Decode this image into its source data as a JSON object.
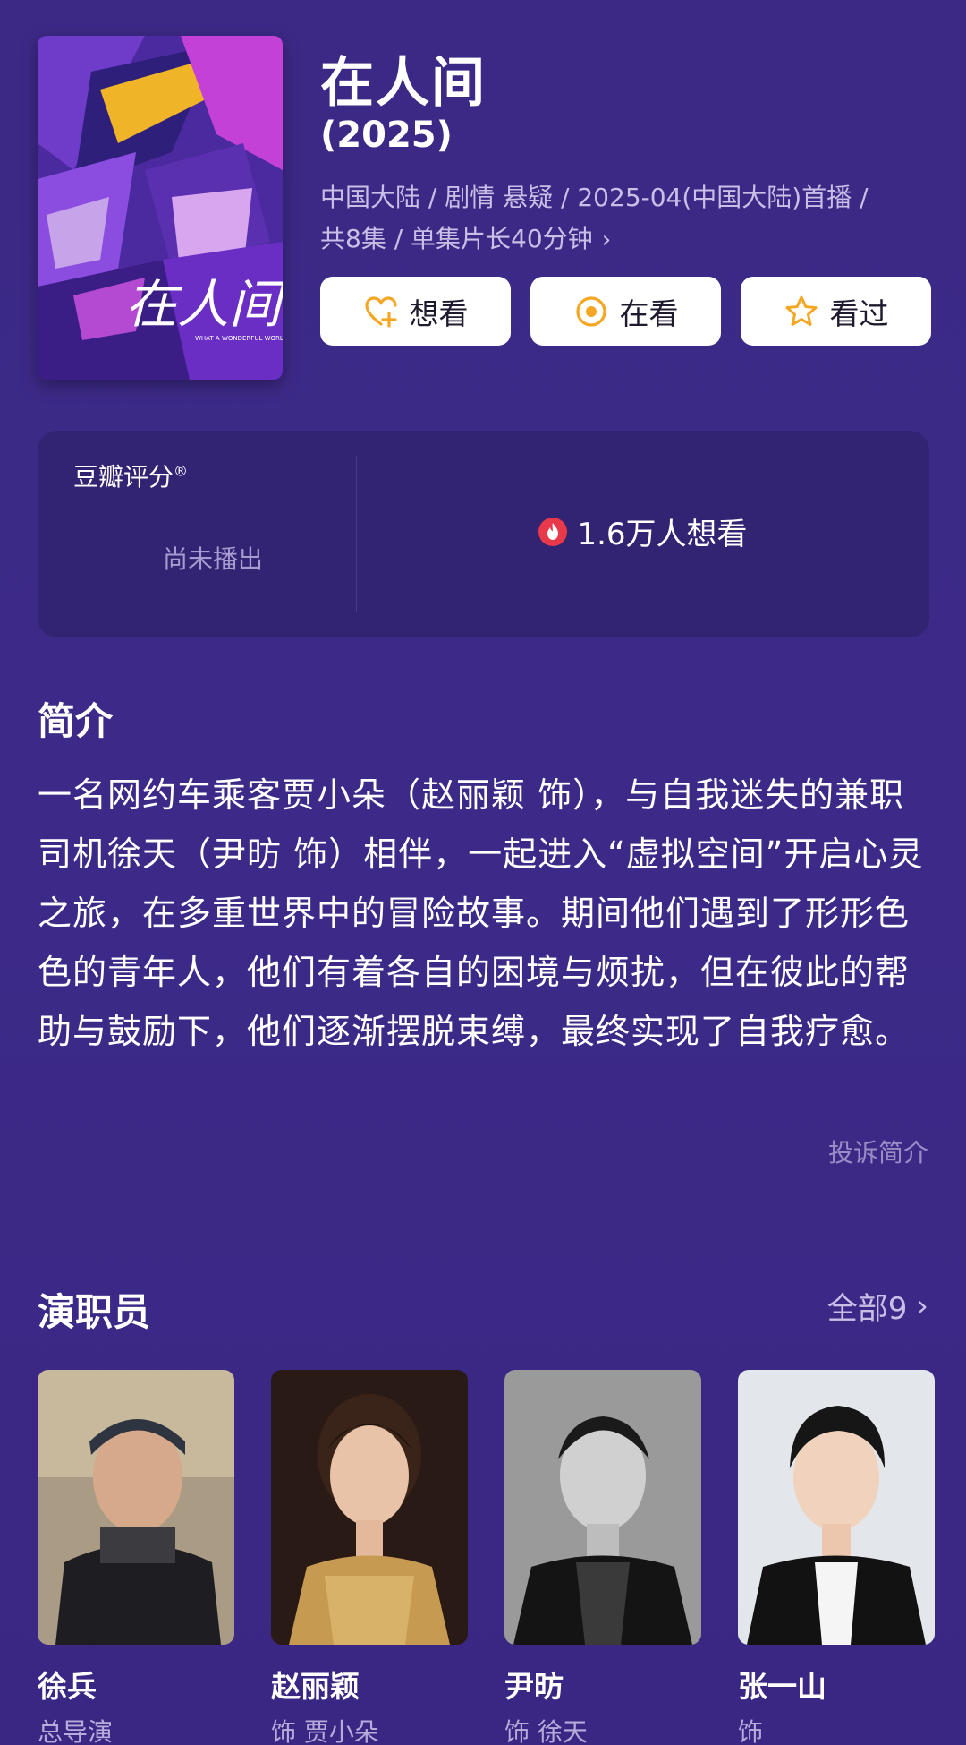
{
  "header": {
    "title": "在人间",
    "year": "(2025)",
    "meta_line1": "中国大陆 / 剧情 悬疑 / 2025-04(中国大陆)首播 /",
    "meta_line2": "共8集 / 单集片长40分钟",
    "poster_text": "在人间",
    "poster_subtitle": "WHAT A WONDERFUL WORLD"
  },
  "actions": [
    {
      "label": "想看",
      "icon": "heart-plus-icon"
    },
    {
      "label": "在看",
      "icon": "dot-circle-icon"
    },
    {
      "label": "看过",
      "icon": "star-icon"
    }
  ],
  "rating": {
    "title": "豆瓣评分",
    "mark": "®",
    "status": "尚未播出",
    "want_count": "1.6万人想看"
  },
  "synopsis": {
    "title": "简介",
    "text": "一名网约车乘客贾小朵（赵丽颖 饰），与自我迷失的兼职司机徐天（尹昉 饰）相伴，一起进入“虚拟空间”开启心灵之旅，在多重世界中的冒险故事。期间他们遇到了形形色色的青年人，他们有着各自的困境与烦扰，但在彼此的帮助与鼓励下，他们逐渐摆脱束缚，最终实现了自我疗愈。",
    "report": "投诉简介"
  },
  "cast": {
    "title": "演职员",
    "all_label": "全部9",
    "members": [
      {
        "name": "徐兵",
        "role": "总导演"
      },
      {
        "name": "赵丽颖",
        "role": "饰 贾小朵"
      },
      {
        "name": "尹昉",
        "role": "饰 徐天"
      },
      {
        "name": "张一山",
        "role": "饰"
      }
    ]
  },
  "colors": {
    "background": "#3d2a88",
    "card": "#332373",
    "button_bg": "#ffffff",
    "icon_orange": "#f5a623",
    "fire_red": "#e8394a"
  }
}
